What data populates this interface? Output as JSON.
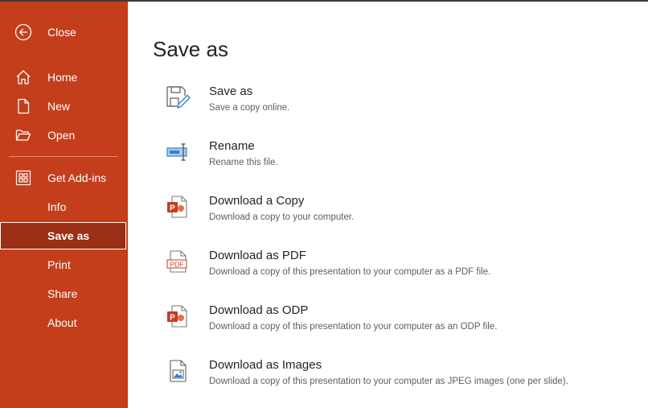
{
  "sidebar": {
    "close": {
      "label": "Close",
      "icon": "back-arrow-icon"
    },
    "items": [
      {
        "id": "home",
        "label": "Home",
        "icon": "home-icon"
      },
      {
        "id": "new",
        "label": "New",
        "icon": "new-document-icon"
      },
      {
        "id": "open",
        "label": "Open",
        "icon": "open-folder-icon"
      },
      {
        "id": "get-add-ins",
        "label": "Get Add-ins",
        "icon": "add-ins-grid-icon"
      },
      {
        "id": "info",
        "label": "Info"
      },
      {
        "id": "save-as",
        "label": "Save as",
        "selected": true
      },
      {
        "id": "print",
        "label": "Print"
      },
      {
        "id": "share",
        "label": "Share"
      },
      {
        "id": "about",
        "label": "About"
      }
    ],
    "colors": {
      "background": "#c43e1c",
      "selected": "#9b2e15"
    }
  },
  "main": {
    "title": "Save as",
    "options": [
      {
        "title": "Save as",
        "description": "Save a copy online.",
        "icon": "save-as-icon"
      },
      {
        "title": "Rename",
        "description": "Rename this file.",
        "icon": "rename-icon"
      },
      {
        "title": "Download a Copy",
        "description": "Download a copy to your computer.",
        "icon": "powerpoint-file-icon"
      },
      {
        "title": "Download as PDF",
        "description": "Download a copy of this presentation to your computer as a PDF file.",
        "icon": "pdf-file-icon",
        "icon_text": "PDF"
      },
      {
        "title": "Download as ODP",
        "description": "Download a copy of this presentation to your computer as an ODP file.",
        "icon": "powerpoint-file-icon"
      },
      {
        "title": "Download as Images",
        "description": "Download a copy of this presentation to your computer as JPEG images (one per slide).",
        "icon": "image-file-icon"
      }
    ],
    "ppt_badge": "P"
  }
}
